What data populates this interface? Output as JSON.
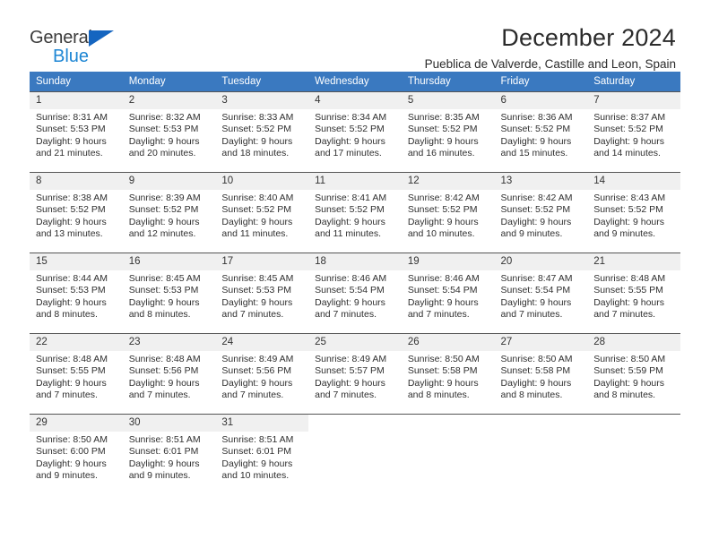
{
  "brand": {
    "name_part1": "General",
    "name_part2": "Blue",
    "triangle_color": "#1565c0",
    "blue_color": "#1d86d4"
  },
  "header": {
    "month_title": "December 2024",
    "location": "Pueblica de Valverde, Castille and Leon, Spain"
  },
  "colors": {
    "header_row_bg": "#3a79c0",
    "daynum_bg": "#f0f0f0",
    "text": "#2f2f2f"
  },
  "weekday_headers": [
    "Sunday",
    "Monday",
    "Tuesday",
    "Wednesday",
    "Thursday",
    "Friday",
    "Saturday"
  ],
  "weeks": [
    [
      {
        "day": "1",
        "sunrise": "Sunrise: 8:31 AM",
        "sunset": "Sunset: 5:53 PM",
        "daylight1": "Daylight: 9 hours",
        "daylight2": "and 21 minutes."
      },
      {
        "day": "2",
        "sunrise": "Sunrise: 8:32 AM",
        "sunset": "Sunset: 5:53 PM",
        "daylight1": "Daylight: 9 hours",
        "daylight2": "and 20 minutes."
      },
      {
        "day": "3",
        "sunrise": "Sunrise: 8:33 AM",
        "sunset": "Sunset: 5:52 PM",
        "daylight1": "Daylight: 9 hours",
        "daylight2": "and 18 minutes."
      },
      {
        "day": "4",
        "sunrise": "Sunrise: 8:34 AM",
        "sunset": "Sunset: 5:52 PM",
        "daylight1": "Daylight: 9 hours",
        "daylight2": "and 17 minutes."
      },
      {
        "day": "5",
        "sunrise": "Sunrise: 8:35 AM",
        "sunset": "Sunset: 5:52 PM",
        "daylight1": "Daylight: 9 hours",
        "daylight2": "and 16 minutes."
      },
      {
        "day": "6",
        "sunrise": "Sunrise: 8:36 AM",
        "sunset": "Sunset: 5:52 PM",
        "daylight1": "Daylight: 9 hours",
        "daylight2": "and 15 minutes."
      },
      {
        "day": "7",
        "sunrise": "Sunrise: 8:37 AM",
        "sunset": "Sunset: 5:52 PM",
        "daylight1": "Daylight: 9 hours",
        "daylight2": "and 14 minutes."
      }
    ],
    [
      {
        "day": "8",
        "sunrise": "Sunrise: 8:38 AM",
        "sunset": "Sunset: 5:52 PM",
        "daylight1": "Daylight: 9 hours",
        "daylight2": "and 13 minutes."
      },
      {
        "day": "9",
        "sunrise": "Sunrise: 8:39 AM",
        "sunset": "Sunset: 5:52 PM",
        "daylight1": "Daylight: 9 hours",
        "daylight2": "and 12 minutes."
      },
      {
        "day": "10",
        "sunrise": "Sunrise: 8:40 AM",
        "sunset": "Sunset: 5:52 PM",
        "daylight1": "Daylight: 9 hours",
        "daylight2": "and 11 minutes."
      },
      {
        "day": "11",
        "sunrise": "Sunrise: 8:41 AM",
        "sunset": "Sunset: 5:52 PM",
        "daylight1": "Daylight: 9 hours",
        "daylight2": "and 11 minutes."
      },
      {
        "day": "12",
        "sunrise": "Sunrise: 8:42 AM",
        "sunset": "Sunset: 5:52 PM",
        "daylight1": "Daylight: 9 hours",
        "daylight2": "and 10 minutes."
      },
      {
        "day": "13",
        "sunrise": "Sunrise: 8:42 AM",
        "sunset": "Sunset: 5:52 PM",
        "daylight1": "Daylight: 9 hours",
        "daylight2": "and 9 minutes."
      },
      {
        "day": "14",
        "sunrise": "Sunrise: 8:43 AM",
        "sunset": "Sunset: 5:52 PM",
        "daylight1": "Daylight: 9 hours",
        "daylight2": "and 9 minutes."
      }
    ],
    [
      {
        "day": "15",
        "sunrise": "Sunrise: 8:44 AM",
        "sunset": "Sunset: 5:53 PM",
        "daylight1": "Daylight: 9 hours",
        "daylight2": "and 8 minutes."
      },
      {
        "day": "16",
        "sunrise": "Sunrise: 8:45 AM",
        "sunset": "Sunset: 5:53 PM",
        "daylight1": "Daylight: 9 hours",
        "daylight2": "and 8 minutes."
      },
      {
        "day": "17",
        "sunrise": "Sunrise: 8:45 AM",
        "sunset": "Sunset: 5:53 PM",
        "daylight1": "Daylight: 9 hours",
        "daylight2": "and 7 minutes."
      },
      {
        "day": "18",
        "sunrise": "Sunrise: 8:46 AM",
        "sunset": "Sunset: 5:54 PM",
        "daylight1": "Daylight: 9 hours",
        "daylight2": "and 7 minutes."
      },
      {
        "day": "19",
        "sunrise": "Sunrise: 8:46 AM",
        "sunset": "Sunset: 5:54 PM",
        "daylight1": "Daylight: 9 hours",
        "daylight2": "and 7 minutes."
      },
      {
        "day": "20",
        "sunrise": "Sunrise: 8:47 AM",
        "sunset": "Sunset: 5:54 PM",
        "daylight1": "Daylight: 9 hours",
        "daylight2": "and 7 minutes."
      },
      {
        "day": "21",
        "sunrise": "Sunrise: 8:48 AM",
        "sunset": "Sunset: 5:55 PM",
        "daylight1": "Daylight: 9 hours",
        "daylight2": "and 7 minutes."
      }
    ],
    [
      {
        "day": "22",
        "sunrise": "Sunrise: 8:48 AM",
        "sunset": "Sunset: 5:55 PM",
        "daylight1": "Daylight: 9 hours",
        "daylight2": "and 7 minutes."
      },
      {
        "day": "23",
        "sunrise": "Sunrise: 8:48 AM",
        "sunset": "Sunset: 5:56 PM",
        "daylight1": "Daylight: 9 hours",
        "daylight2": "and 7 minutes."
      },
      {
        "day": "24",
        "sunrise": "Sunrise: 8:49 AM",
        "sunset": "Sunset: 5:56 PM",
        "daylight1": "Daylight: 9 hours",
        "daylight2": "and 7 minutes."
      },
      {
        "day": "25",
        "sunrise": "Sunrise: 8:49 AM",
        "sunset": "Sunset: 5:57 PM",
        "daylight1": "Daylight: 9 hours",
        "daylight2": "and 7 minutes."
      },
      {
        "day": "26",
        "sunrise": "Sunrise: 8:50 AM",
        "sunset": "Sunset: 5:58 PM",
        "daylight1": "Daylight: 9 hours",
        "daylight2": "and 8 minutes."
      },
      {
        "day": "27",
        "sunrise": "Sunrise: 8:50 AM",
        "sunset": "Sunset: 5:58 PM",
        "daylight1": "Daylight: 9 hours",
        "daylight2": "and 8 minutes."
      },
      {
        "day": "28",
        "sunrise": "Sunrise: 8:50 AM",
        "sunset": "Sunset: 5:59 PM",
        "daylight1": "Daylight: 9 hours",
        "daylight2": "and 8 minutes."
      }
    ],
    [
      {
        "day": "29",
        "sunrise": "Sunrise: 8:50 AM",
        "sunset": "Sunset: 6:00 PM",
        "daylight1": "Daylight: 9 hours",
        "daylight2": "and 9 minutes."
      },
      {
        "day": "30",
        "sunrise": "Sunrise: 8:51 AM",
        "sunset": "Sunset: 6:01 PM",
        "daylight1": "Daylight: 9 hours",
        "daylight2": "and 9 minutes."
      },
      {
        "day": "31",
        "sunrise": "Sunrise: 8:51 AM",
        "sunset": "Sunset: 6:01 PM",
        "daylight1": "Daylight: 9 hours",
        "daylight2": "and 10 minutes."
      },
      {
        "day": "",
        "sunrise": "",
        "sunset": "",
        "daylight1": "",
        "daylight2": ""
      },
      {
        "day": "",
        "sunrise": "",
        "sunset": "",
        "daylight1": "",
        "daylight2": ""
      },
      {
        "day": "",
        "sunrise": "",
        "sunset": "",
        "daylight1": "",
        "daylight2": ""
      },
      {
        "day": "",
        "sunrise": "",
        "sunset": "",
        "daylight1": "",
        "daylight2": ""
      }
    ]
  ]
}
